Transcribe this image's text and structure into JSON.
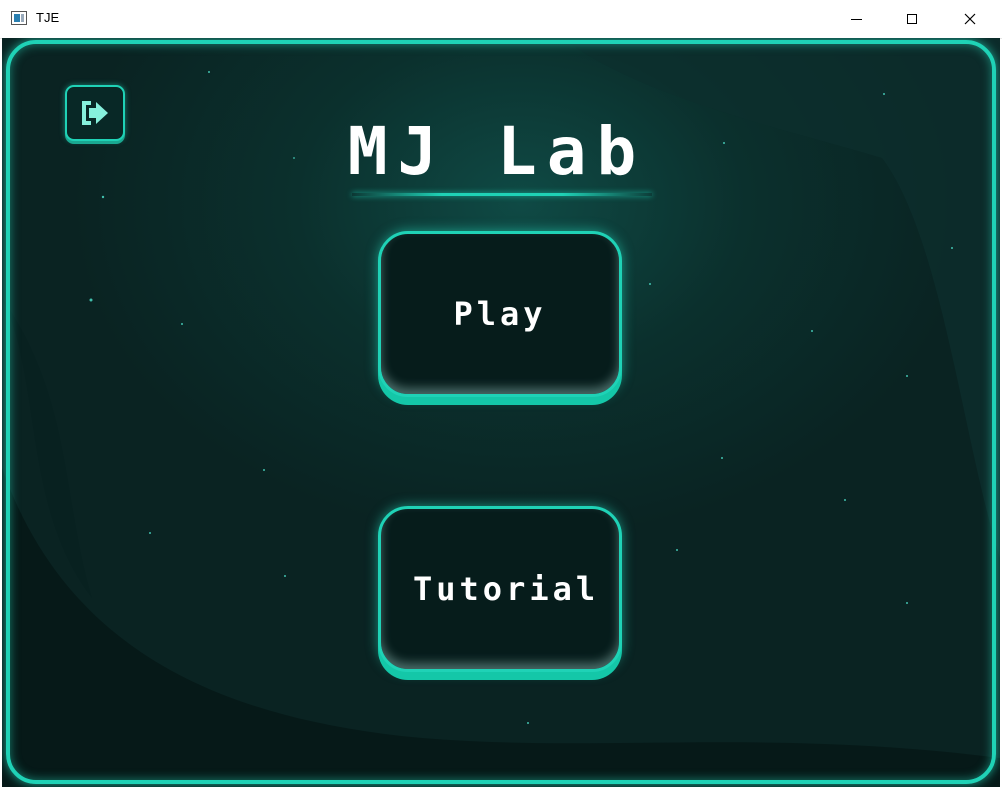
{
  "window": {
    "title": "TJE",
    "controls": [
      "minimize",
      "maximize",
      "close"
    ],
    "close_glyph": "✕"
  },
  "game": {
    "title": "MJ Lab",
    "exit_icon": "exit-arrow-icon",
    "menu": {
      "play_label": "Play",
      "tutorial_label": "Tutorial"
    },
    "colors": {
      "background": "#0a2322",
      "accent": "#1fd2b6",
      "text": "#ffffff"
    }
  }
}
